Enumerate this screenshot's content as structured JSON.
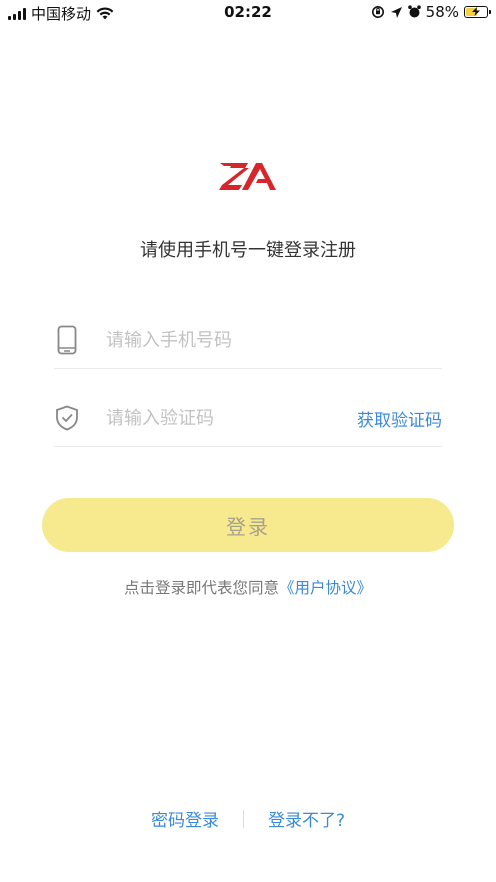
{
  "status_bar": {
    "carrier": "中国移动",
    "time": "02:22",
    "battery_percent": "58%",
    "battery_level": 0.58
  },
  "logo": {
    "text": "ZA",
    "color": "#d6252b"
  },
  "subtitle": "请使用手机号一键登录注册",
  "phone_field": {
    "placeholder": "请输入手机号码",
    "value": ""
  },
  "code_field": {
    "placeholder": "请输入验证码",
    "value": "",
    "get_code_label": "获取验证码"
  },
  "login_button": {
    "label": "登录",
    "color": "#f7ea8e"
  },
  "agreement": {
    "prefix": "点击登录即代表您同意",
    "link": "《用户协议》"
  },
  "footer": {
    "password_login": "密码登录",
    "cannot_login": "登录不了?"
  },
  "colors": {
    "accent": "#3b8ad9",
    "placeholder": "#c2c2c2"
  }
}
